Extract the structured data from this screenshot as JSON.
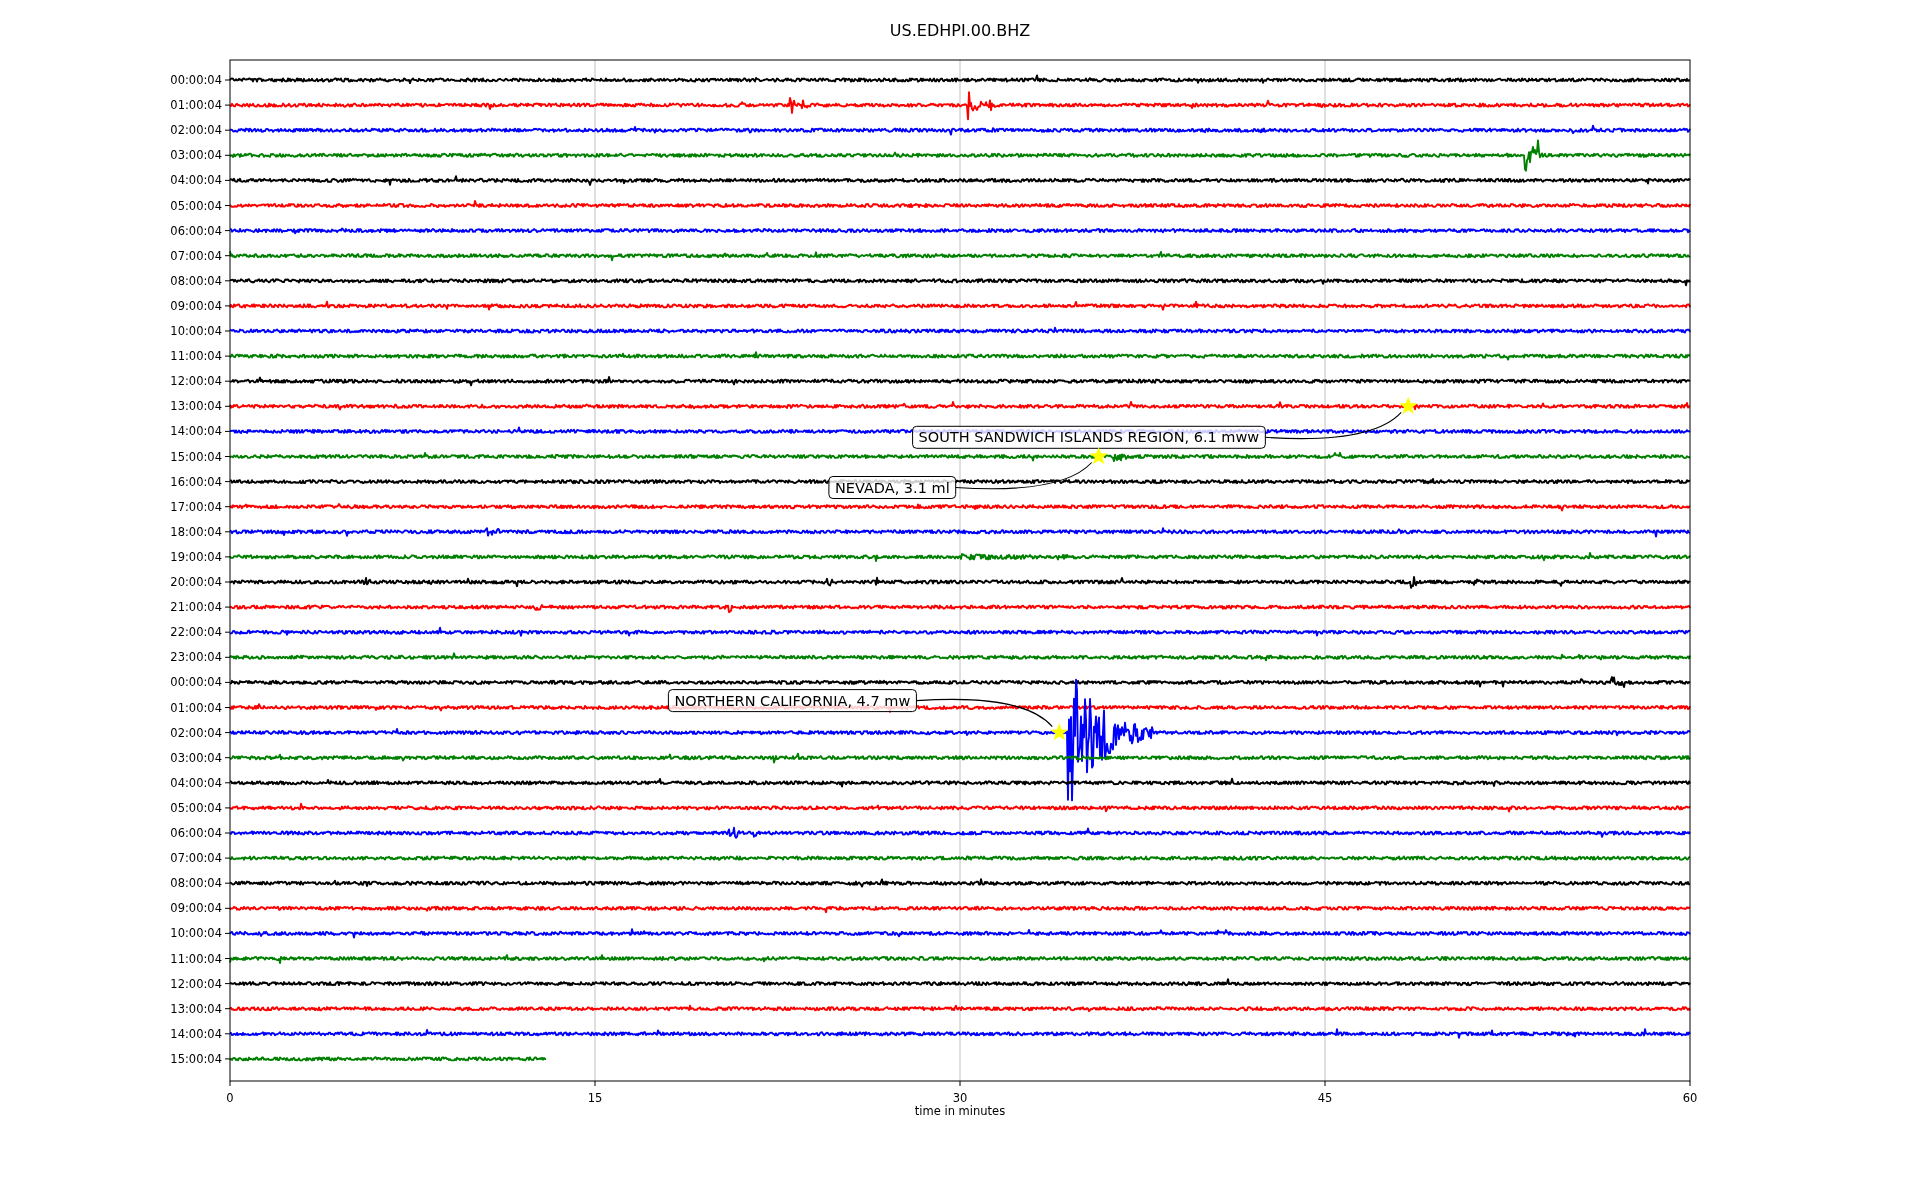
{
  "title": "US.EDHPI.00.BHZ",
  "xlabel": "time in minutes",
  "xticks": [
    "0",
    "15",
    "30",
    "45",
    "60"
  ],
  "rows": [
    {
      "label": "00:00:04",
      "color": "#000000",
      "level": 1
    },
    {
      "label": "01:00:04",
      "color": "#ff0000",
      "level": 1
    },
    {
      "label": "02:00:04",
      "color": "#0000ff",
      "level": 1
    },
    {
      "label": "03:00:04",
      "color": "#008000",
      "level": 1
    },
    {
      "label": "04:00:04",
      "color": "#000000",
      "level": 1
    },
    {
      "label": "05:00:04",
      "color": "#ff0000",
      "level": 1
    },
    {
      "label": "06:00:04",
      "color": "#0000ff",
      "level": 1
    },
    {
      "label": "07:00:04",
      "color": "#008000",
      "level": 1
    },
    {
      "label": "08:00:04",
      "color": "#000000",
      "level": 1
    },
    {
      "label": "09:00:04",
      "color": "#ff0000",
      "level": 1
    },
    {
      "label": "10:00:04",
      "color": "#0000ff",
      "level": 1
    },
    {
      "label": "11:00:04",
      "color": "#008000",
      "level": 1
    },
    {
      "label": "12:00:04",
      "color": "#000000",
      "level": 1
    },
    {
      "label": "13:00:04",
      "color": "#ff0000",
      "level": 1,
      "event": {
        "label": "SOUTH SANDWICH ISLANDS REGION, 6.1 mww",
        "level": 0.807,
        "above": false
      }
    },
    {
      "label": "14:00:04",
      "color": "#0000ff",
      "level": 1
    },
    {
      "label": "15:00:04",
      "color": "#008000",
      "level": 1,
      "event": {
        "label": "NEVADA, 3.1 ml",
        "level": 0.595,
        "above": false
      }
    },
    {
      "label": "16:00:04",
      "color": "#000000",
      "level": 1
    },
    {
      "label": "17:00:04",
      "color": "#ff0000",
      "level": 1
    },
    {
      "label": "18:00:04",
      "color": "#0000ff",
      "level": 1
    },
    {
      "label": "19:00:04",
      "color": "#008000",
      "level": 1
    },
    {
      "label": "20:00:04",
      "color": "#000000",
      "level": 1
    },
    {
      "label": "21:00:04",
      "color": "#ff0000",
      "level": 1
    },
    {
      "label": "22:00:04",
      "color": "#0000ff",
      "level": 1
    },
    {
      "label": "23:00:04",
      "color": "#008000",
      "level": 1
    },
    {
      "label": "00:00:04",
      "color": "#000000",
      "level": 1
    },
    {
      "label": "01:00:04",
      "color": "#ff0000",
      "level": 1
    },
    {
      "label": "02:00:04",
      "color": "#0000ff",
      "level": 1,
      "event": {
        "label": "NORTHERN CALIFORNIA, 4.7 mw",
        "level": 0.568,
        "above": true
      }
    },
    {
      "label": "03:00:04",
      "color": "#008000",
      "level": 1
    },
    {
      "label": "04:00:04",
      "color": "#000000",
      "level": 1
    },
    {
      "label": "05:00:04",
      "color": "#ff0000",
      "level": 1
    },
    {
      "label": "06:00:04",
      "color": "#0000ff",
      "level": 1
    },
    {
      "label": "07:00:04",
      "color": "#008000",
      "level": 1
    },
    {
      "label": "08:00:04",
      "color": "#000000",
      "level": 1
    },
    {
      "label": "09:00:04",
      "color": "#ff0000",
      "level": 1
    },
    {
      "label": "10:00:04",
      "color": "#0000ff",
      "level": 1
    },
    {
      "label": "11:00:04",
      "color": "#008000",
      "level": 1
    },
    {
      "label": "12:00:04",
      "color": "#000000",
      "level": 1
    },
    {
      "label": "13:00:04",
      "color": "#ff0000",
      "level": 1
    },
    {
      "label": "14:00:04",
      "color": "#0000ff",
      "level": 1
    },
    {
      "label": "15:00:04",
      "color": "#008000",
      "level": 0.217
    }
  ]
}
